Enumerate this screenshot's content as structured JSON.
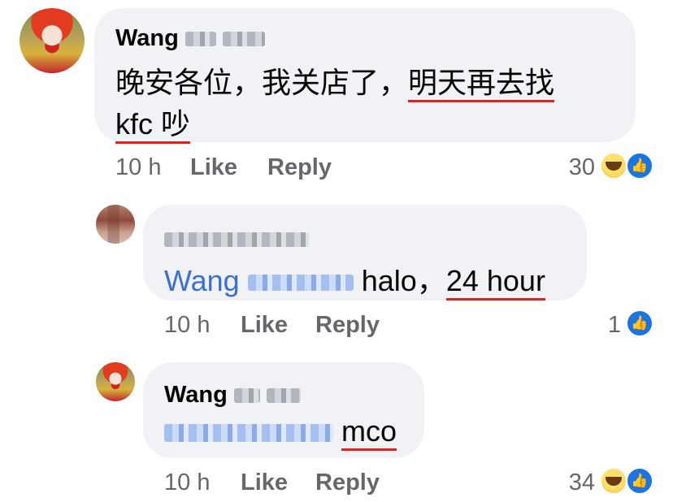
{
  "comments": [
    {
      "author": "Wang",
      "text_plain": "晚安各位，我关店了，",
      "text_underlined_1": "明天再去找",
      "text_underlined_2": "kfc 吵",
      "time": "10 h",
      "like_label": "Like",
      "reply_label": "Reply",
      "reaction_count": "30",
      "reactions": [
        "haha-icon",
        "like-icon"
      ]
    },
    {
      "mention": "Wang",
      "text_plain": "halo，",
      "text_underlined": "24 hour",
      "time": "10 h",
      "like_label": "Like",
      "reply_label": "Reply",
      "reaction_count": "1",
      "reactions": [
        "like-icon"
      ]
    },
    {
      "author": "Wang",
      "text_underlined": "mco",
      "time": "10 h",
      "like_label": "Like",
      "reply_label": "Reply",
      "reaction_count": "34",
      "reactions": [
        "haha-icon",
        "like-icon"
      ]
    }
  ],
  "colors": {
    "bubble": "#f0f2f5",
    "mention": "#3b6fd6",
    "underline": "#e0201c",
    "meta": "#65676b",
    "like_reaction": "#1b74e4"
  }
}
